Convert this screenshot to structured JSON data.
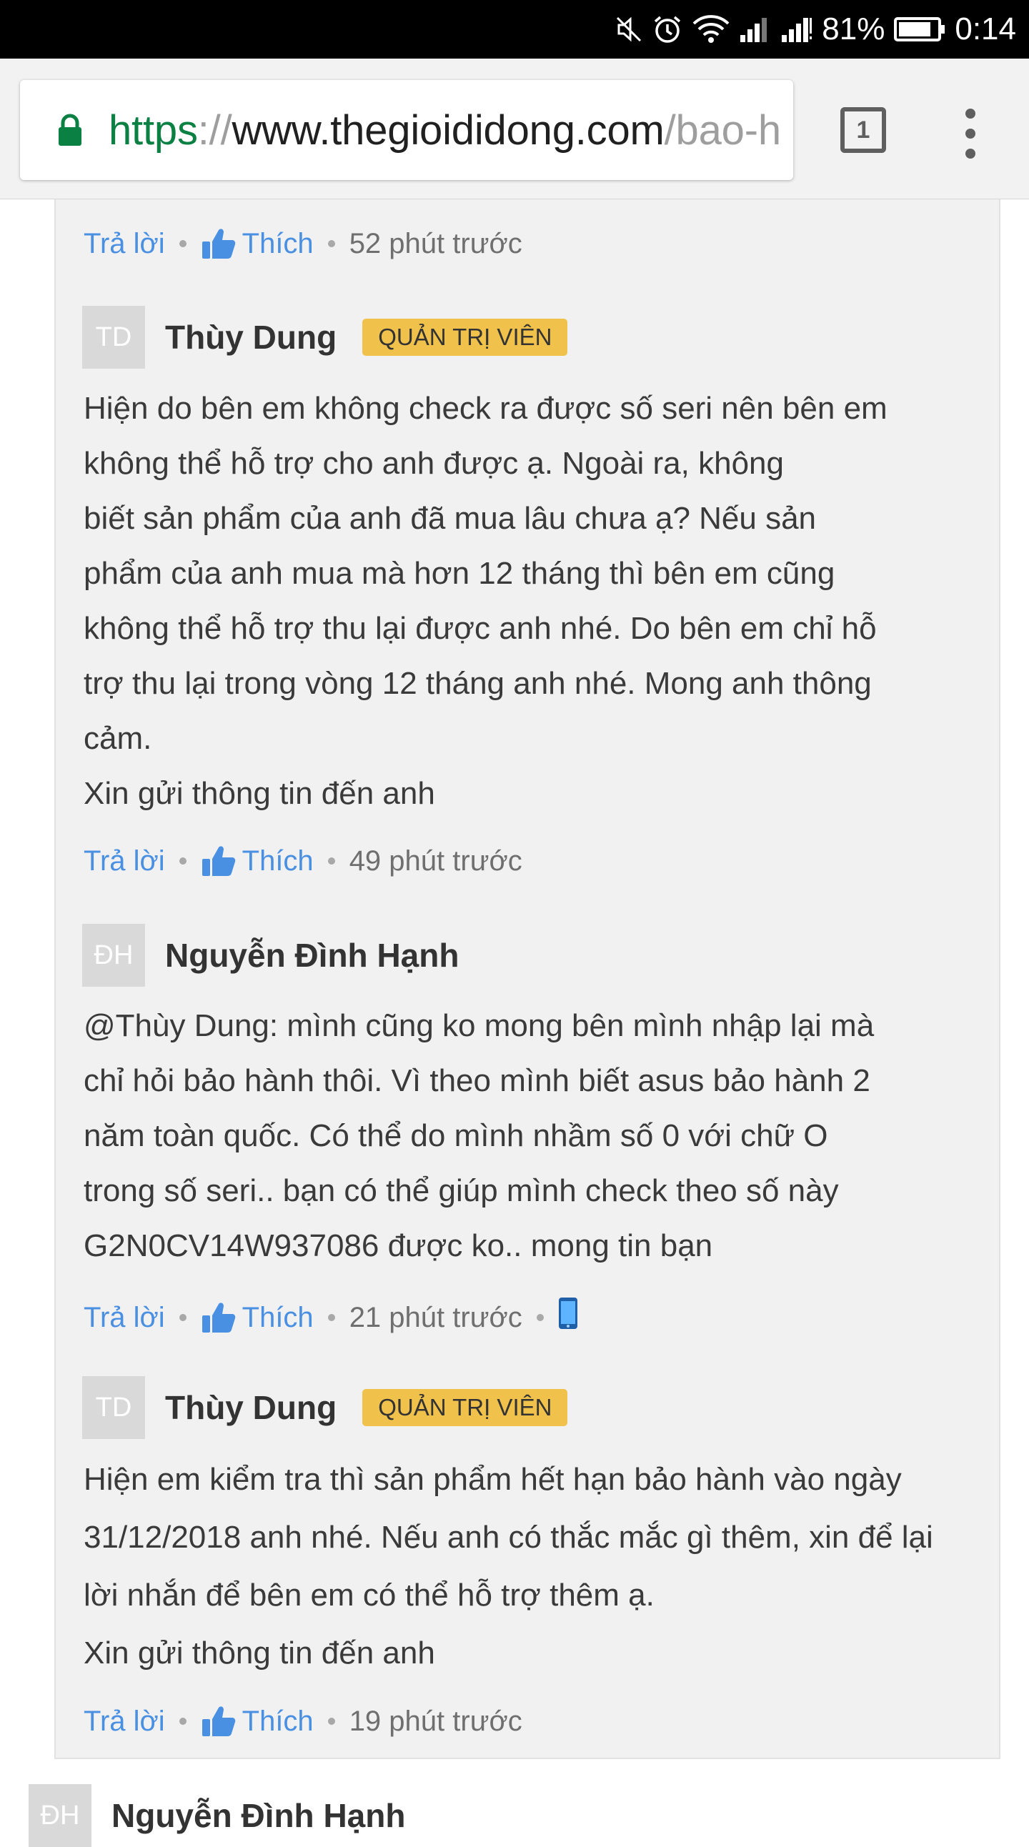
{
  "status_bar": {
    "battery_percent": "81%",
    "time": "0:14",
    "icons": [
      "mute-icon",
      "alarm-icon",
      "wifi-icon",
      "signal-icon",
      "signal-icon",
      "battery-icon"
    ]
  },
  "browser": {
    "url_scheme": "https",
    "url_separator": "://",
    "url_host": "www.thegioididong.com",
    "url_path": "/bao-h",
    "tab_count": "1",
    "lock_color": "#0b8043"
  },
  "labels": {
    "reply": "Trả lời",
    "like": "Thích"
  },
  "comments": [
    {
      "time": "52 phút trước"
    },
    {
      "avatar": "TD",
      "author": "Thùy Dung",
      "badge": "QUẢN TRỊ VIÊN",
      "lines": [
        "Hiện do bên em không check ra được số seri nên bên em",
        "không thể hỗ trợ cho anh được ạ. Ngoài ra, không",
        "biết sản phẩm của anh đã mua lâu chưa ạ? Nếu sản",
        "phẩm của anh mua mà hơn 12 tháng thì bên em cũng",
        "không thể hỗ trợ thu lại được anh nhé. Do bên em chỉ hỗ",
        "trợ thu lại trong vòng 12 tháng anh nhé. Mong anh thông",
        "cảm.",
        "Xin gửi thông tin đến anh"
      ],
      "time": "49 phút trước"
    },
    {
      "avatar": "ĐH",
      "author": "Nguyễn Đình Hạnh",
      "lines": [
        "@Thùy Dung: mình cũng ko mong bên mình nhập lại mà",
        "chỉ hỏi bảo hành thôi. Vì theo mình biết asus bảo hành 2",
        "năm toàn quốc. Có thể do mình nhầm số 0 với chữ O",
        "trong số seri.. bạn có thể giúp mình check theo số này",
        "G2N0CV14W937086 được ko.. mong tin bạn"
      ],
      "time": "21 phút trước",
      "device": "mobile-phone-icon"
    },
    {
      "avatar": "TD",
      "author": "Thùy Dung",
      "badge": "QUẢN TRỊ VIÊN",
      "lines": [
        "Hiện em kiểm tra thì sản phẩm hết hạn bảo hành vào ngày",
        "31/12/2018 anh nhé. Nếu anh có thắc mắc gì thêm, xin để lại",
        "lời nhắn để bên em có thể hỗ trợ thêm ạ.",
        "Xin gửi thông tin đến anh"
      ],
      "time": "19 phút trước"
    }
  ],
  "next_comment": {
    "avatar": "ĐH",
    "author": "Nguyễn Đình Hạnh"
  }
}
